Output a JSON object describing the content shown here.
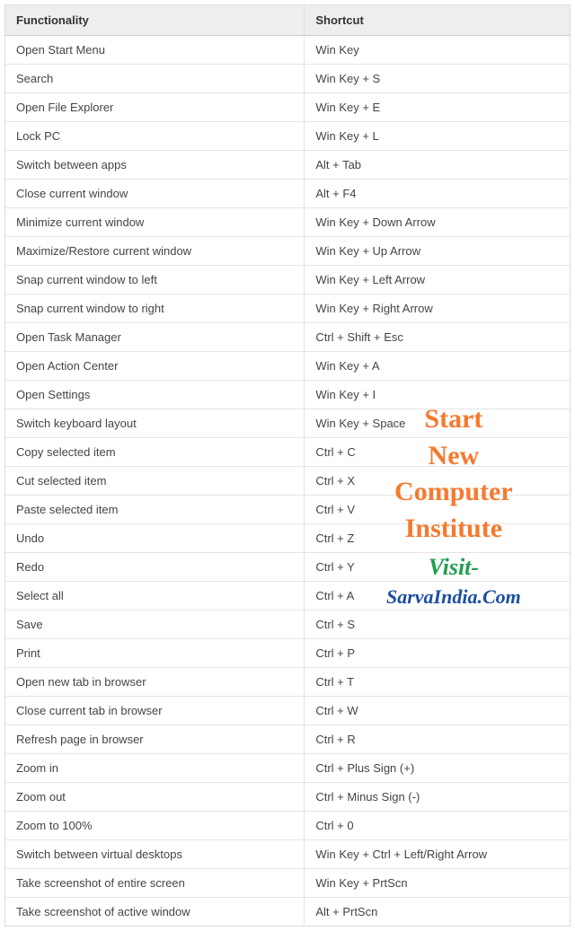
{
  "headers": {
    "functionality": "Functionality",
    "shortcut": "Shortcut"
  },
  "rows": [
    {
      "func": "Open Start Menu",
      "short": "Win Key"
    },
    {
      "func": "Search",
      "short": "Win Key + S"
    },
    {
      "func": "Open File Explorer",
      "short": "Win Key + E"
    },
    {
      "func": "Lock PC",
      "short": "Win Key + L"
    },
    {
      "func": "Switch between apps",
      "short": "Alt + Tab"
    },
    {
      "func": "Close current window",
      "short": "Alt + F4"
    },
    {
      "func": "Minimize current window",
      "short": "Win Key + Down Arrow"
    },
    {
      "func": "Maximize/Restore current window",
      "short": "Win Key + Up Arrow"
    },
    {
      "func": "Snap current window to left",
      "short": "Win Key + Left Arrow"
    },
    {
      "func": "Snap current window to right",
      "short": "Win Key + Right Arrow"
    },
    {
      "func": "Open Task Manager",
      "short": "Ctrl + Shift + Esc"
    },
    {
      "func": "Open Action Center",
      "short": "Win Key + A"
    },
    {
      "func": "Open Settings",
      "short": "Win Key + I"
    },
    {
      "func": "Switch keyboard layout",
      "short": "Win Key + Space"
    },
    {
      "func": "Copy selected item",
      "short": "Ctrl + C"
    },
    {
      "func": "Cut selected item",
      "short": "Ctrl + X"
    },
    {
      "func": "Paste selected item",
      "short": "Ctrl + V"
    },
    {
      "func": "Undo",
      "short": "Ctrl + Z"
    },
    {
      "func": "Redo",
      "short": "Ctrl + Y"
    },
    {
      "func": "Select all",
      "short": "Ctrl + A"
    },
    {
      "func": "Save",
      "short": "Ctrl + S"
    },
    {
      "func": "Print",
      "short": "Ctrl + P"
    },
    {
      "func": "Open new tab in browser",
      "short": "Ctrl + T"
    },
    {
      "func": "Close current tab in browser",
      "short": "Ctrl + W"
    },
    {
      "func": "Refresh page in browser",
      "short": "Ctrl + R"
    },
    {
      "func": "Zoom in",
      "short": "Ctrl + Plus Sign (+)"
    },
    {
      "func": "Zoom out",
      "short": "Ctrl + Minus Sign (-)"
    },
    {
      "func": "Zoom to 100%",
      "short": "Ctrl + 0"
    },
    {
      "func": "Switch between virtual desktops",
      "short": "Win Key + Ctrl + Left/Right Arrow"
    },
    {
      "func": "Take screenshot of entire screen",
      "short": "Win Key + PrtScn"
    },
    {
      "func": "Take screenshot of active window",
      "short": "Alt + PrtScn"
    }
  ],
  "overlay": {
    "line1a": "Start",
    "line1b": "New",
    "line1c": "Computer",
    "line1d": "Institute",
    "line2": "Visit-",
    "line3": "SarvaIndia.Com"
  }
}
